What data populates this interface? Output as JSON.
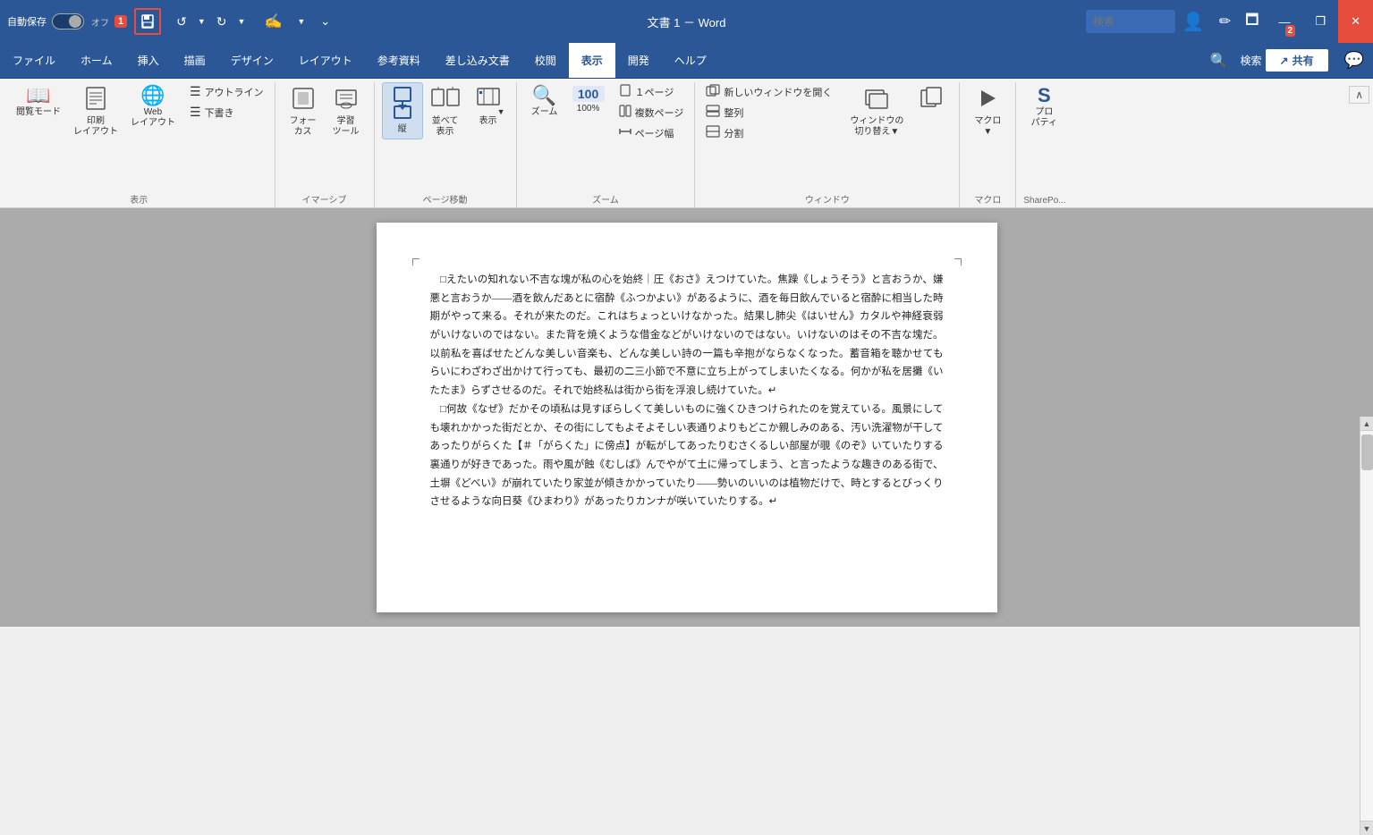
{
  "titlebar": {
    "autosave_label": "自動保存",
    "toggle_state": "オフ",
    "badge_1": "1",
    "badge_2": "2",
    "title": "文書 1 － Word",
    "undo_label": "元に戻す",
    "redo_label": "やり直す",
    "close_label": "×",
    "minimize_label": "—",
    "restore_label": "❐"
  },
  "menubar": {
    "items": [
      {
        "label": "ファイル",
        "active": false
      },
      {
        "label": "ホーム",
        "active": false
      },
      {
        "label": "挿入",
        "active": false
      },
      {
        "label": "描画",
        "active": false
      },
      {
        "label": "デザイン",
        "active": false
      },
      {
        "label": "レイアウト",
        "active": false
      },
      {
        "label": "参考資料",
        "active": false
      },
      {
        "label": "差し込み文書",
        "active": false
      },
      {
        "label": "校閲",
        "active": false
      },
      {
        "label": "表示",
        "active": true
      },
      {
        "label": "開発",
        "active": false
      },
      {
        "label": "ヘルプ",
        "active": false
      }
    ],
    "share_label": "共有",
    "search_placeholder": "検索"
  },
  "ribbon": {
    "groups": [
      {
        "label": "表示",
        "buttons": [
          {
            "icon": "📖",
            "label": "閲覧モード",
            "name": "reading-mode-btn"
          },
          {
            "icon": "🖨",
            "label": "印刷\nレイアウト",
            "name": "print-layout-btn"
          },
          {
            "icon": "🌐",
            "label": "Web\nレイアウト",
            "name": "web-layout-btn"
          }
        ],
        "small_buttons": [
          {
            "icon": "≡",
            "label": "アウトライン"
          },
          {
            "icon": "≡",
            "label": "下書き"
          }
        ]
      },
      {
        "label": "イマーシブ",
        "buttons": [
          {
            "icon": "📄",
            "label": "フォー\nカス",
            "name": "focus-btn"
          },
          {
            "icon": "📚",
            "label": "学習\nツール",
            "name": "learning-tools-btn"
          }
        ]
      },
      {
        "label": "ページ移動",
        "buttons": [
          {
            "icon": "↕",
            "label": "縦",
            "name": "vertical-btn",
            "active": true
          },
          {
            "icon": "⇆",
            "label": "並べて\n表示",
            "name": "side-by-side-btn"
          },
          {
            "icon": "📊",
            "label": "表示",
            "name": "display-btn",
            "has_dropdown": true
          }
        ]
      },
      {
        "label": "ズーム",
        "buttons": [
          {
            "icon": "🔍",
            "label": "ズーム",
            "name": "zoom-btn"
          },
          {
            "icon": "100",
            "label": "100%",
            "name": "zoom-100-btn"
          }
        ],
        "small_buttons2": [
          {
            "icon": "□",
            "label": "1ページ"
          },
          {
            "icon": "□□",
            "label": "複数ページ"
          },
          {
            "icon": "↔",
            "label": "ページ幅"
          }
        ]
      },
      {
        "label": "ウィンドウ",
        "buttons": [
          {
            "icon": "□↗",
            "label": "新しいウィンドウを開く",
            "name": "new-window-btn",
            "small": true
          },
          {
            "icon": "≡≡",
            "label": "整列",
            "name": "arrange-btn",
            "small": true
          },
          {
            "icon": "||",
            "label": "分割",
            "name": "split-btn",
            "small": true
          }
        ],
        "buttons2": [
          {
            "icon": "🖥",
            "label": "ウィンドウの\n切り替え▼",
            "name": "switch-window-btn"
          },
          {
            "icon": "📋",
            "label": "",
            "name": "copy-btn"
          }
        ]
      },
      {
        "label": "マクロ",
        "buttons": [
          {
            "icon": "▶",
            "label": "マクロ\n▼",
            "name": "macro-btn"
          }
        ]
      },
      {
        "label": "SharePo...",
        "buttons": [
          {
            "icon": "S",
            "label": "プロ\nパティ",
            "name": "properties-btn"
          }
        ]
      }
    ]
  },
  "document": {
    "paragraphs": [
      "□えたいの知れない不吉な塊が私の心を始終｜圧《おさ》えつけていた。焦躁《しょうそう》と言おうか、嫌悪と言おうか——酒を飲んだあとに宿酔《ふつかよい》があるように、酒を毎日飲んでいると宿酔に相当した時期がやって来る。それが来たのだ。これはちょっといけなかった。結果し肺尖《はいせん》カタルや神経衰弱がいけないのではない。また背を焼くような借金などがいけないのではない。いけないのはその不吉な塊だ。以前私を喜ばせたどんな美しい音楽も、どんな美しい詩の一篇も辛抱がならなくなった。蓄音箱を聴かせてもらいにわざわざ出かけて行っても、最初の二三小節で不意に立ち上がってしまいたくなる。何かが私を居攤《いたたま》らずさせるのだ。それで始終私は街から街を浮浪し続けていた。↵",
      "□何故《なぜ》だかその頃私は見すぼらしくて美しいものに強くひきつけられたのを覚えている。風景にしても壊れかかった街だとか、その街にしてもよそよそしい表通りよりもどこか親しみのある、汚い洗濯物が干してあったりがらくた【＃「がらくた」に傍点】が転がしてあったりむさくるしい部屋が覗《のぞ》いていたりする裏通りが好きであった。雨や風が蝕《むしば》んでやがて土に帰ってしまう、と言ったような趣きのある街で、土塀《どべい》が崩れていたり家並が傾きかかっていたり——勢いのいいのは植物だけで、時とするとびっくりさせるような向日葵《ひまわり》があったりカンナが咲いていたりする。↵"
    ]
  }
}
